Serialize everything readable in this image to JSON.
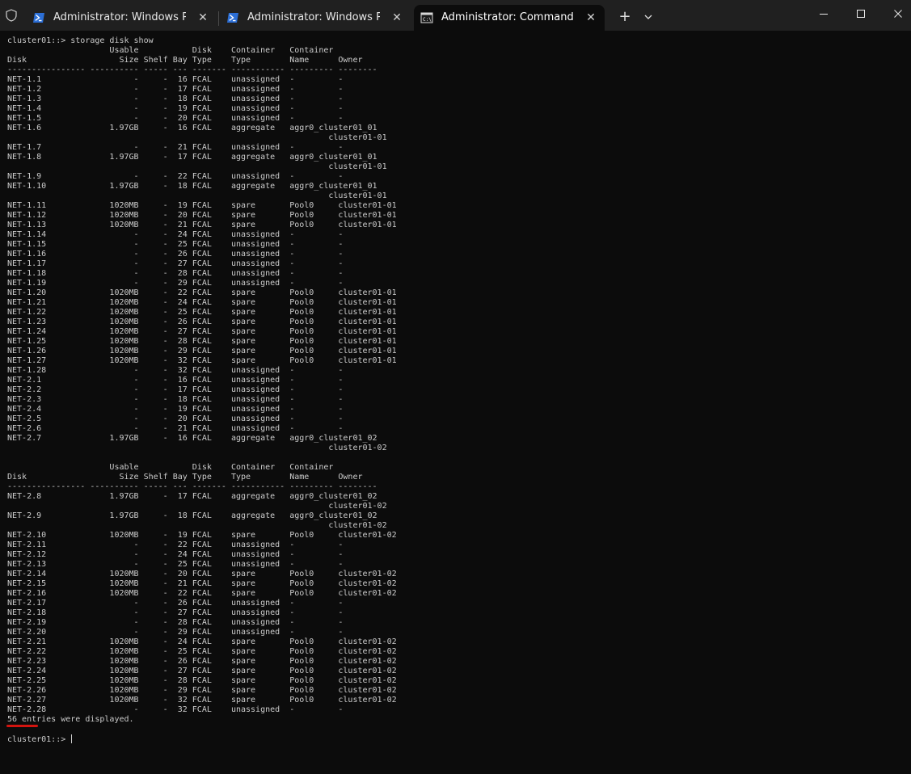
{
  "tabs": [
    {
      "label": "Administrator: Windows PowerShell",
      "icon": "powershell-icon",
      "active": false
    },
    {
      "label": "Administrator: Windows PowerShell",
      "icon": "powershell-icon",
      "active": false
    },
    {
      "label": "Administrator: Command Prompt",
      "icon": "command-prompt-icon",
      "active": true
    }
  ],
  "tabbar": {
    "new_tab": "+",
    "close_glyph": "✕"
  },
  "colors": {
    "terminal_background": "#0c0c0c",
    "terminal_text": "#cccccc",
    "tabbar_background": "#202020",
    "annotation_underline": "#d3140f"
  },
  "console": {
    "lines": [
      "cluster01::> storage disk show",
      "                     Usable           Disk    Container   Container",
      "Disk                   Size Shelf Bay Type    Type        Name      Owner",
      "---------------- ---------- ----- --- ------- ----------- --------- --------",
      "NET-1.1                   -     -  16 FCAL    unassigned  -         -",
      "NET-1.2                   -     -  17 FCAL    unassigned  -         -",
      "NET-1.3                   -     -  18 FCAL    unassigned  -         -",
      "NET-1.4                   -     -  19 FCAL    unassigned  -         -",
      "NET-1.5                   -     -  20 FCAL    unassigned  -         -",
      "NET-1.6              1.97GB     -  16 FCAL    aggregate   aggr0_cluster01_01",
      "                                                                  cluster01-01",
      "NET-1.7                   -     -  21 FCAL    unassigned  -         -",
      "NET-1.8              1.97GB     -  17 FCAL    aggregate   aggr0_cluster01_01",
      "                                                                  cluster01-01",
      "NET-1.9                   -     -  22 FCAL    unassigned  -         -",
      "NET-1.10             1.97GB     -  18 FCAL    aggregate   aggr0_cluster01_01",
      "                                                                  cluster01-01",
      "NET-1.11             1020MB     -  19 FCAL    spare       Pool0     cluster01-01",
      "NET-1.12             1020MB     -  20 FCAL    spare       Pool0     cluster01-01",
      "NET-1.13             1020MB     -  21 FCAL    spare       Pool0     cluster01-01",
      "NET-1.14                  -     -  24 FCAL    unassigned  -         -",
      "NET-1.15                  -     -  25 FCAL    unassigned  -         -",
      "NET-1.16                  -     -  26 FCAL    unassigned  -         -",
      "NET-1.17                  -     -  27 FCAL    unassigned  -         -",
      "NET-1.18                  -     -  28 FCAL    unassigned  -         -",
      "NET-1.19                  -     -  29 FCAL    unassigned  -         -",
      "NET-1.20             1020MB     -  22 FCAL    spare       Pool0     cluster01-01",
      "NET-1.21             1020MB     -  24 FCAL    spare       Pool0     cluster01-01",
      "NET-1.22             1020MB     -  25 FCAL    spare       Pool0     cluster01-01",
      "NET-1.23             1020MB     -  26 FCAL    spare       Pool0     cluster01-01",
      "NET-1.24             1020MB     -  27 FCAL    spare       Pool0     cluster01-01",
      "NET-1.25             1020MB     -  28 FCAL    spare       Pool0     cluster01-01",
      "NET-1.26             1020MB     -  29 FCAL    spare       Pool0     cluster01-01",
      "NET-1.27             1020MB     -  32 FCAL    spare       Pool0     cluster01-01",
      "NET-1.28                  -     -  32 FCAL    unassigned  -         -",
      "NET-2.1                   -     -  16 FCAL    unassigned  -         -",
      "NET-2.2                   -     -  17 FCAL    unassigned  -         -",
      "NET-2.3                   -     -  18 FCAL    unassigned  -         -",
      "NET-2.4                   -     -  19 FCAL    unassigned  -         -",
      "NET-2.5                   -     -  20 FCAL    unassigned  -         -",
      "NET-2.6                   -     -  21 FCAL    unassigned  -         -",
      "NET-2.7              1.97GB     -  16 FCAL    aggregate   aggr0_cluster01_02",
      "                                                                  cluster01-02",
      "",
      "                     Usable           Disk    Container   Container",
      "Disk                   Size Shelf Bay Type    Type        Name      Owner",
      "---------------- ---------- ----- --- ------- ----------- --------- --------",
      "NET-2.8              1.97GB     -  17 FCAL    aggregate   aggr0_cluster01_02",
      "                                                                  cluster01-02",
      "NET-2.9              1.97GB     -  18 FCAL    aggregate   aggr0_cluster01_02",
      "                                                                  cluster01-02",
      "NET-2.10             1020MB     -  19 FCAL    spare       Pool0     cluster01-02",
      "NET-2.11                  -     -  22 FCAL    unassigned  -         -",
      "NET-2.12                  -     -  24 FCAL    unassigned  -         -",
      "NET-2.13                  -     -  25 FCAL    unassigned  -         -",
      "NET-2.14             1020MB     -  20 FCAL    spare       Pool0     cluster01-02",
      "NET-2.15             1020MB     -  21 FCAL    spare       Pool0     cluster01-02",
      "NET-2.16             1020MB     -  22 FCAL    spare       Pool0     cluster01-02",
      "NET-2.17                  -     -  26 FCAL    unassigned  -         -",
      "NET-2.18                  -     -  27 FCAL    unassigned  -         -",
      "NET-2.19                  -     -  28 FCAL    unassigned  -         -",
      "NET-2.20                  -     -  29 FCAL    unassigned  -         -",
      "NET-2.21             1020MB     -  24 FCAL    spare       Pool0     cluster01-02",
      "NET-2.22             1020MB     -  25 FCAL    spare       Pool0     cluster01-02",
      "NET-2.23             1020MB     -  26 FCAL    spare       Pool0     cluster01-02",
      "NET-2.24             1020MB     -  27 FCAL    spare       Pool0     cluster01-02",
      "NET-2.25             1020MB     -  28 FCAL    spare       Pool0     cluster01-02",
      "NET-2.26             1020MB     -  29 FCAL    spare       Pool0     cluster01-02",
      "NET-2.27             1020MB     -  32 FCAL    spare       Pool0     cluster01-02",
      "NET-2.28                  -     -  32 FCAL    unassigned  -         -",
      "56 entries were displayed.",
      "",
      "cluster01::> "
    ]
  }
}
